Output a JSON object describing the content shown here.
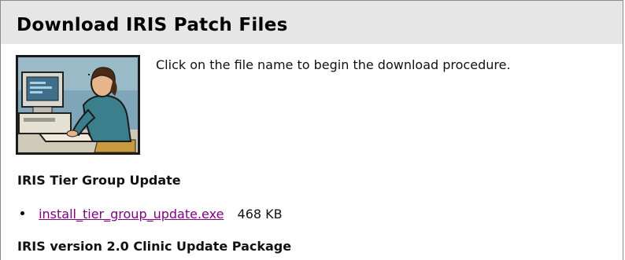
{
  "header": {
    "title": "Download IRIS Patch Files"
  },
  "intro": {
    "text": "Click on the file name to begin the download procedure.",
    "illustration_icon": "person-at-computer-illustration"
  },
  "sections": [
    {
      "heading": "IRIS Tier Group Update",
      "files": [
        {
          "name": "install_tier_group_update.exe",
          "size": "468 KB"
        }
      ]
    },
    {
      "heading": "IRIS version 2.0 Clinic Update Package",
      "files": []
    }
  ],
  "colors": {
    "title_bar_bg": "#e6e6e6",
    "visited_link": "#800080",
    "border": "#8a8a8a"
  }
}
